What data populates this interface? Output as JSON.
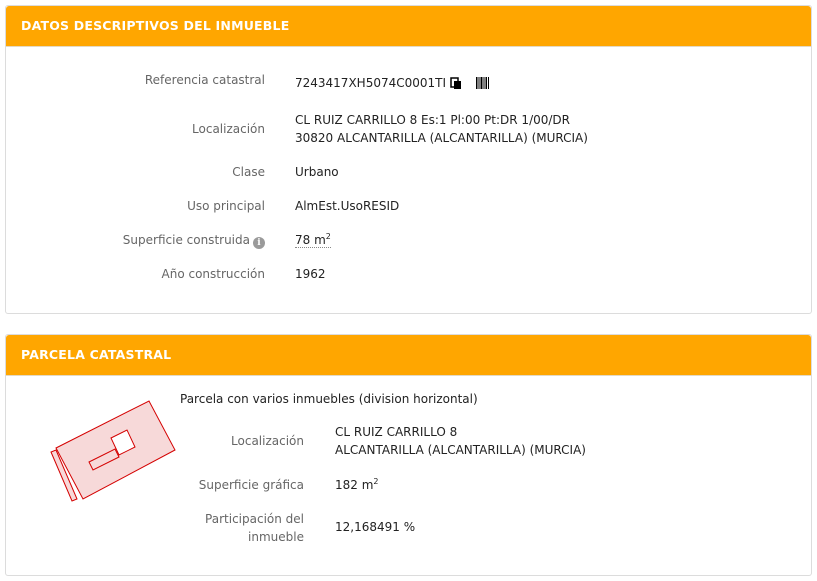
{
  "datos": {
    "header": "DATOS DESCRIPTIVOS DEL INMUEBLE",
    "referencia_label": "Referencia catastral",
    "referencia_value": "7243417XH5074C0001TI",
    "localizacion_label": "Localización",
    "localizacion_line1": "CL RUIZ CARRILLO 8 Es:1 Pl:00 Pt:DR 1/00/DR",
    "localizacion_line2": "30820 ALCANTARILLA (ALCANTARILLA) (MURCIA)",
    "clase_label": "Clase",
    "clase_value": "Urbano",
    "uso_label": "Uso principal",
    "uso_value": "AlmEst.UsoRESID",
    "superficie_label": "Superficie construida",
    "superficie_value": "78 m",
    "superficie_sup": "2",
    "anio_label": "Año construcción",
    "anio_value": "1962"
  },
  "parcela": {
    "header": "PARCELA CATASTRAL",
    "descripcion": "Parcela con varios inmuebles (division horizontal)",
    "localizacion_label": "Localización",
    "localizacion_line1": "CL RUIZ CARRILLO 8",
    "localizacion_line2": "ALCANTARILLA (ALCANTARILLA) (MURCIA)",
    "superficie_label": "Superficie gráfica",
    "superficie_value": "182 m",
    "superficie_sup": "2",
    "participacion_label_line1": "Participación del",
    "participacion_label_line2": "inmueble",
    "participacion_value": "12,168491 %"
  },
  "icons": {
    "info": "info-icon",
    "copy": "copy-icon",
    "barcode": "barcode-icon"
  },
  "colors": {
    "header_bg": "#FFA600",
    "parcel_fill": "#F7D9D9",
    "parcel_stroke": "#D40000"
  }
}
